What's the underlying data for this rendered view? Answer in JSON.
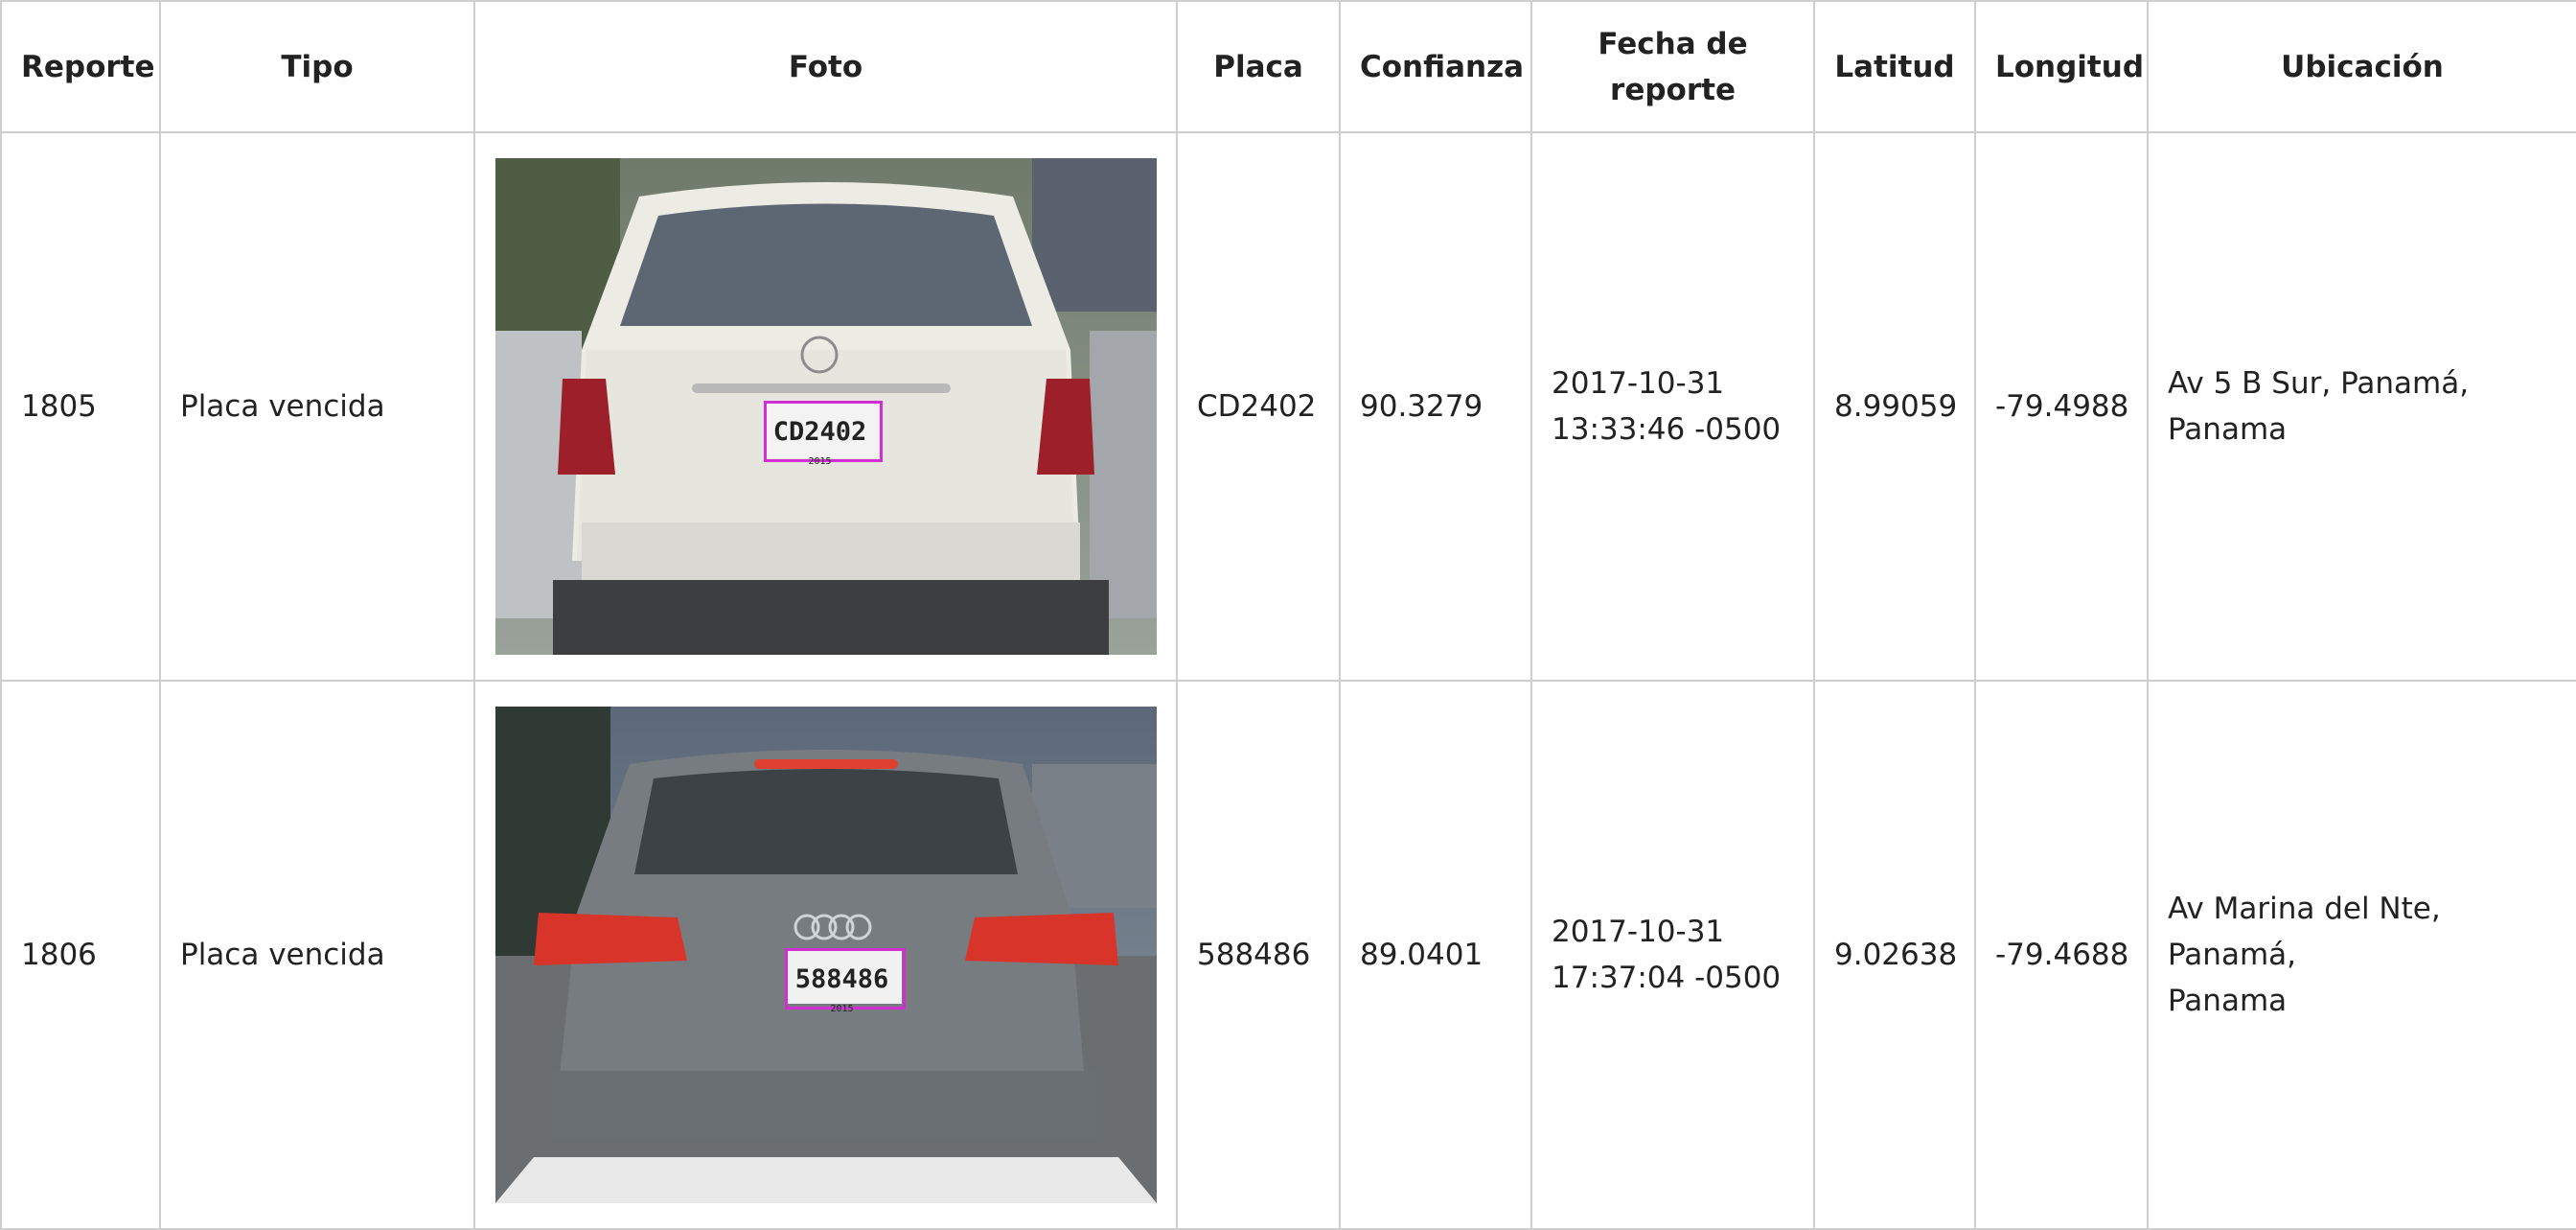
{
  "headers": {
    "reporte": "Reporte",
    "tipo": "Tipo",
    "foto": "Foto",
    "placa": "Placa",
    "confianza": "Confianza",
    "fecha_l1": "Fecha de",
    "fecha_l2": "reporte",
    "latitud": "Latitud",
    "longitud": "Longitud",
    "ubicacion": "Ubicación"
  },
  "rows": [
    {
      "reporte": "1805",
      "tipo": "Placa vencida",
      "foto": {
        "plate_text": "CD2402",
        "plate_year": "2015",
        "detection_color": "#d22fd2"
      },
      "placa": "CD2402",
      "confianza": "90.3279",
      "fecha_l1": "2017-10-31",
      "fecha_l2": "13:33:46 -0500",
      "latitud": "8.99059",
      "longitud": "-79.4988",
      "ubicacion_l1": "Av 5 B Sur, Panamá,",
      "ubicacion_l2": "Panama"
    },
    {
      "reporte": "1806",
      "tipo": "Placa vencida",
      "foto": {
        "plate_text": "588486",
        "plate_year": "2015",
        "detection_color": "#d22fd2"
      },
      "placa": "588486",
      "confianza": "89.0401",
      "fecha_l1": "2017-10-31",
      "fecha_l2": "17:37:04 -0500",
      "latitud": "9.02638",
      "longitud": "-79.4688",
      "ubicacion_l1": "Av Marina del Nte, Panamá,",
      "ubicacion_l2": "Panama"
    }
  ]
}
